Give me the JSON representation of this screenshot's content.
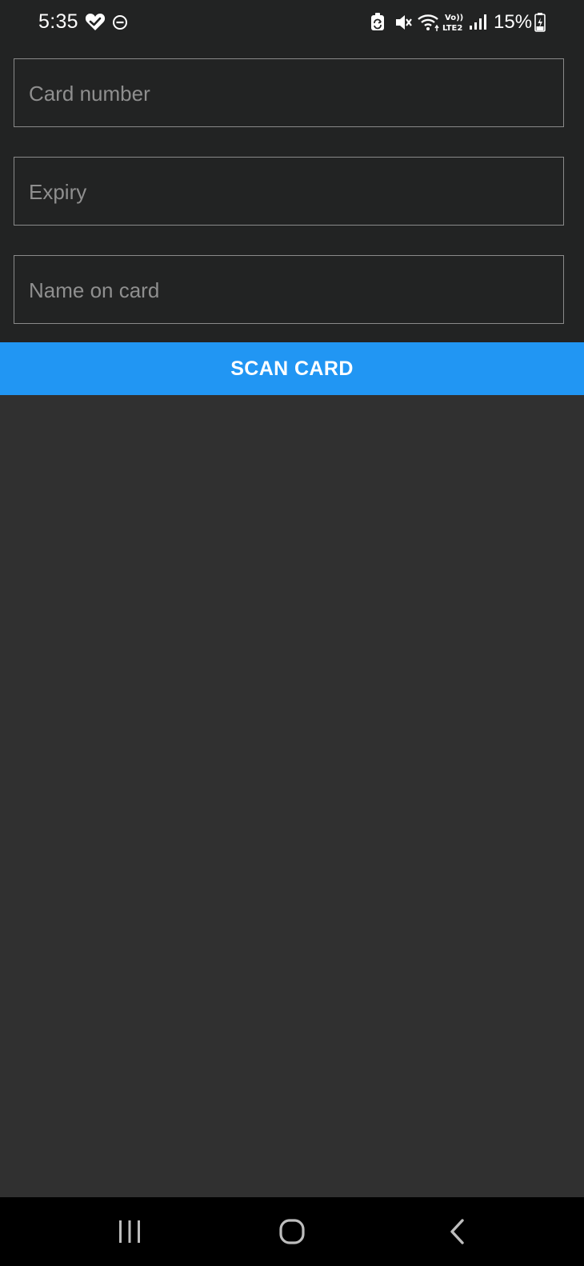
{
  "status_bar": {
    "time": "5:35",
    "battery": "15%",
    "icons": [
      "heart-check-icon",
      "do-not-disturb-icon",
      "battery-saver-icon",
      "mute-icon",
      "wifi-icon",
      "volte-lte2-icon",
      "signal-icon",
      "battery-charging-icon"
    ]
  },
  "form": {
    "card_number_placeholder": "Card number",
    "expiry_placeholder": "Expiry",
    "name_placeholder": "Name on card",
    "scan_button_label": "SCAN CARD"
  },
  "colors": {
    "form_background": "#222323",
    "content_background": "#303030",
    "button_accent": "#2196f3",
    "nav_background": "#000000"
  },
  "nav_bar": {
    "icons": [
      "recents-icon",
      "home-icon",
      "back-icon"
    ]
  }
}
